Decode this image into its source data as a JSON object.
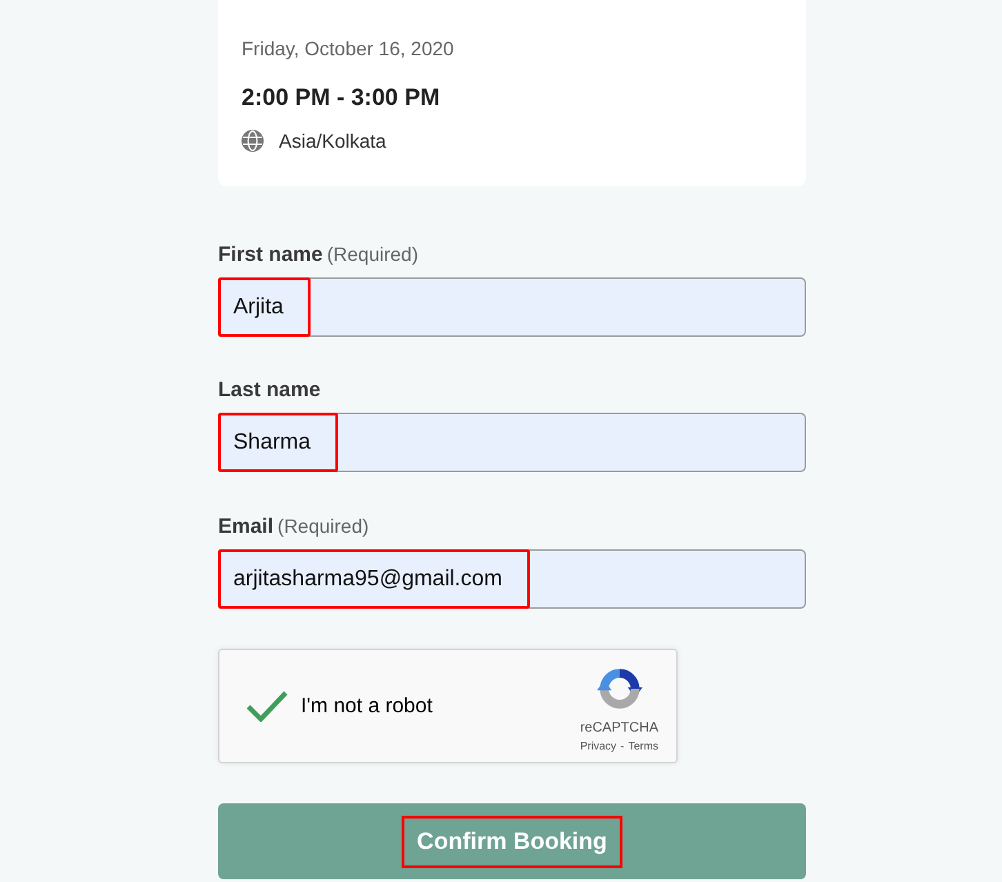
{
  "event": {
    "date": "Friday, October 16, 2020",
    "time": "2:00 PM - 3:00 PM",
    "timezone": "Asia/Kolkata"
  },
  "fields": [
    {
      "label": "First name",
      "note": "(Required)",
      "value": "Arjita",
      "highlighted": true
    },
    {
      "label": "Last name",
      "value": "Sharma",
      "highlighted": true
    },
    {
      "label": "Email",
      "note": "(Required)",
      "value": "arjitasharma95@gmail.com",
      "highlighted": true
    }
  ],
  "captcha": {
    "label": "I'm not a robot",
    "checked": true,
    "brand": "reCAPTCHA",
    "privacy": "Privacy",
    "separator": "-",
    "terms": "Terms"
  },
  "submit": {
    "label": "Confirm Booking",
    "highlighted": true
  }
}
